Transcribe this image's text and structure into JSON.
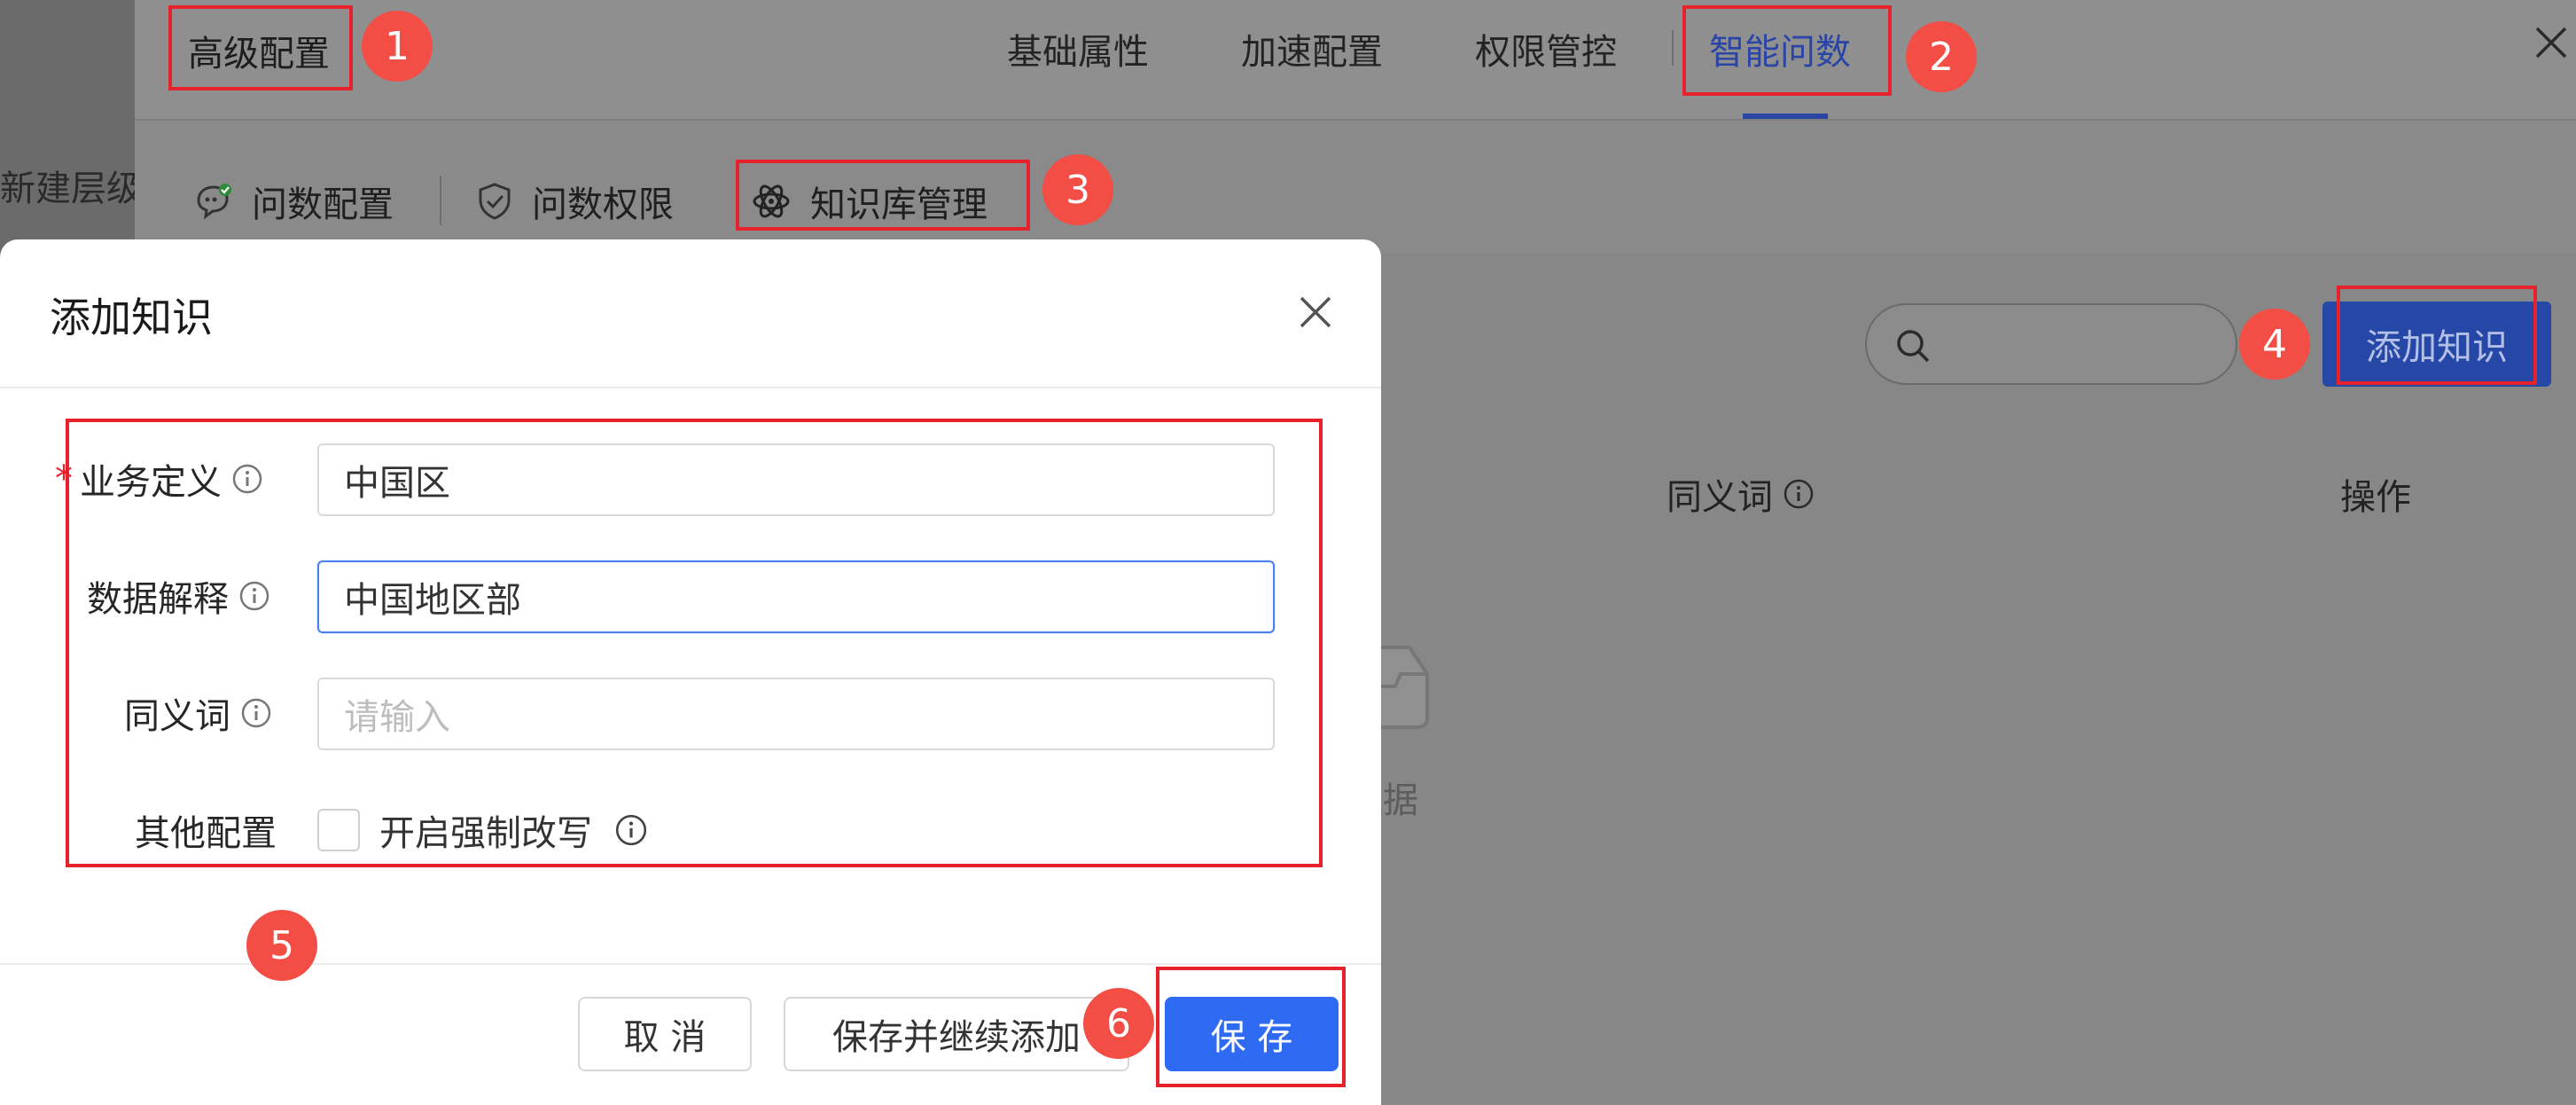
{
  "background": {
    "left_text": "新建层级"
  },
  "drawer": {
    "title": "高级配置",
    "tabs": [
      "基础属性",
      "加速配置",
      "权限管控",
      "智能问数"
    ],
    "active_tab": "智能问数",
    "subtabs": [
      "问数配置",
      "问数权限",
      "知识库管理"
    ],
    "add_knowledge_label": "添加知识",
    "table_headers": {
      "synonym": "同义词",
      "action": "操作"
    },
    "empty_text": "数据"
  },
  "modal": {
    "title": "添加知识",
    "fields": {
      "business_definition": {
        "label": "业务定义",
        "required_mark": "*",
        "value": "中国区"
      },
      "data_explanation": {
        "label": "数据解释",
        "value": "中国地区部"
      },
      "synonym": {
        "label": "同义词",
        "placeholder": "请输入"
      },
      "other_config": {
        "label": "其他配置",
        "checkbox_label": "开启强制改写",
        "checked": false
      }
    },
    "buttons": {
      "cancel": "取 消",
      "save_continue": "保存并继续添加",
      "save": "保 存"
    }
  },
  "annotations": [
    "1",
    "2",
    "3",
    "4",
    "5",
    "6"
  ],
  "colors": {
    "primary": "#2f6bf2",
    "annotation_red": "#e8222d",
    "badge": "#f24e45",
    "active_tab": "#2a45a6"
  }
}
